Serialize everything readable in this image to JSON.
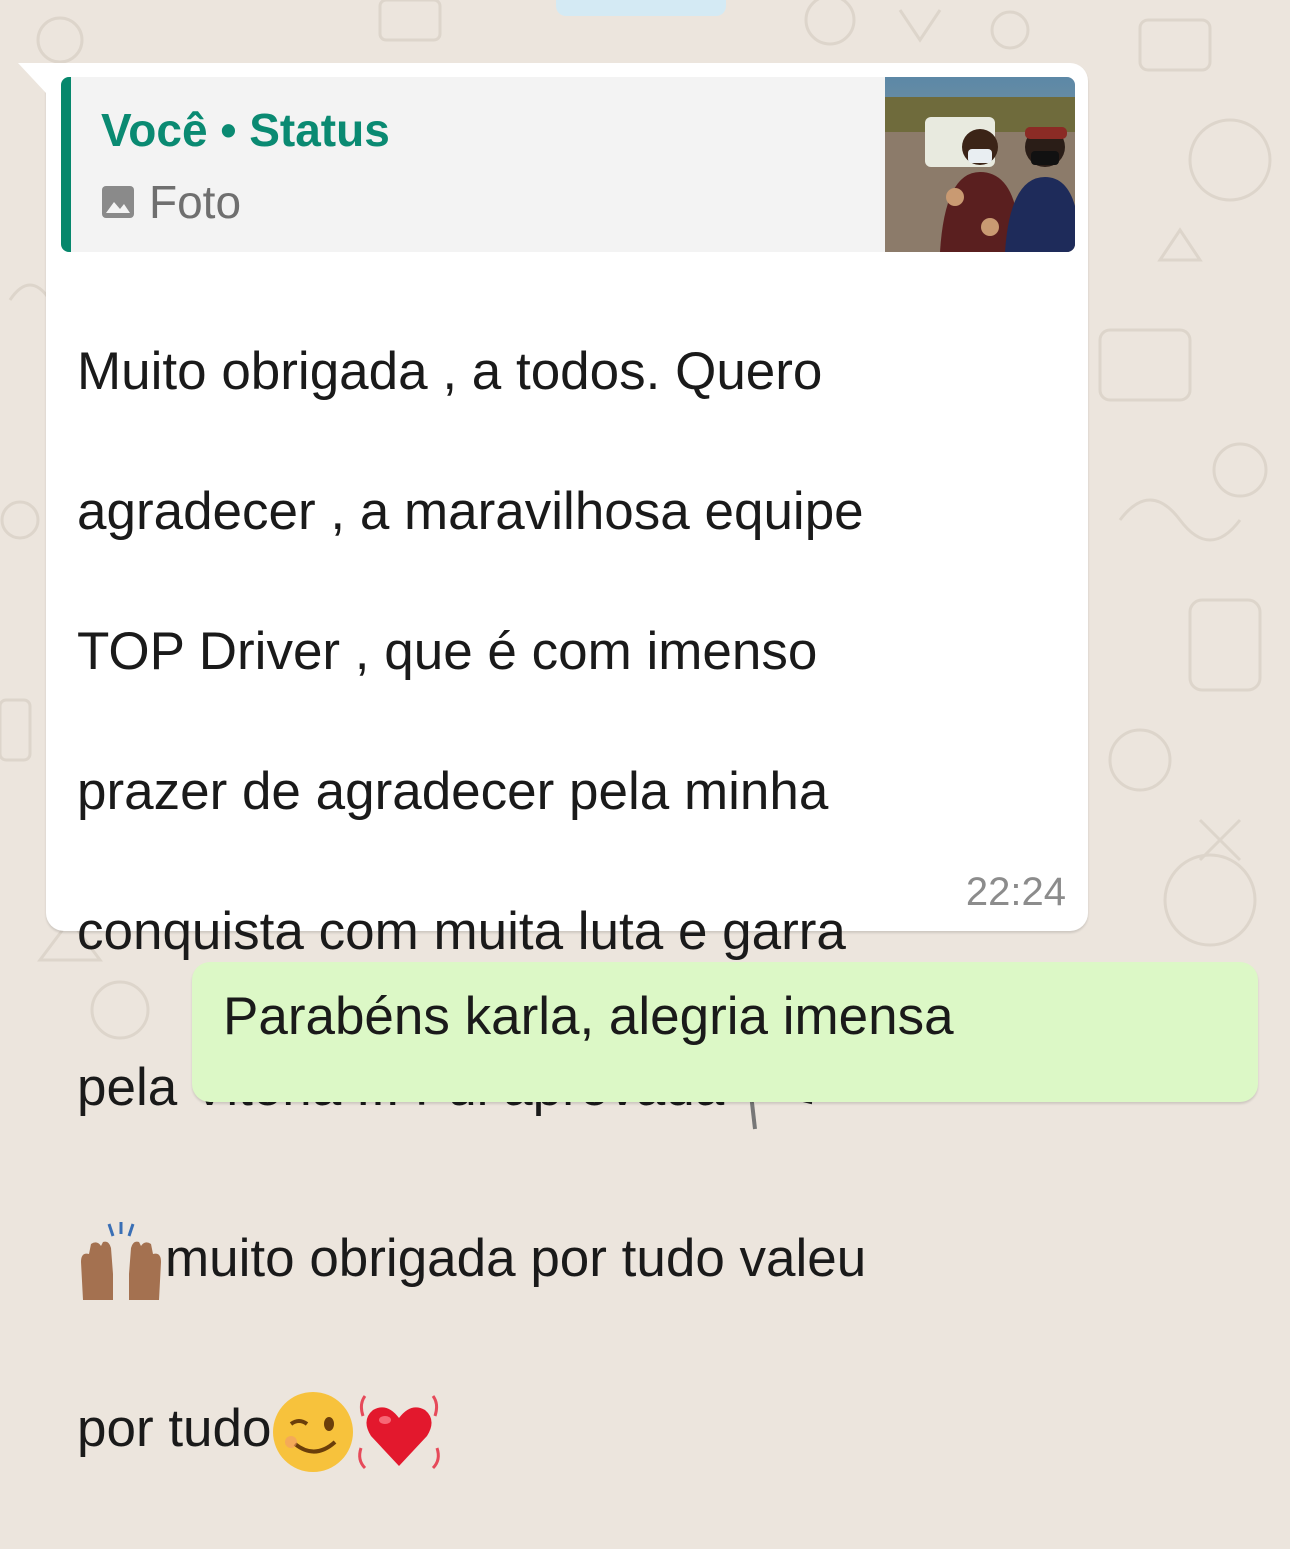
{
  "theme": {
    "chat_background": "#ece5dd",
    "incoming_bubble": "#ffffff",
    "outgoing_bubble": "#dcf8c6",
    "accent": "#0a8a72",
    "timestamp_color": "#8c8c8c"
  },
  "incoming_message": {
    "reply_quote": {
      "author": "Você",
      "separator": " • ",
      "source": "Status",
      "media_icon": "photo-icon",
      "media_label": "Foto",
      "thumbnail": "status-photo-thumbnail"
    },
    "text_lines": [
      "Muito obrigada , a todos. Quero",
      "agradecer  , a maravilhosa  equipe",
      "TOP  Driver , que é com imenso",
      "prazer de agradecer pela minha",
      "conquista com muita luta e garra",
      "pela Vitoria  ... Fui aprovada ",
      "muito obrigada por tudo valeu",
      "por tudo"
    ],
    "emojis": [
      "chequered-flag",
      "raising-hands",
      "winking-face",
      "beating-heart"
    ],
    "time": "22:24"
  },
  "outgoing_message": {
    "text": "Parabéns karla, alegria imensa"
  }
}
